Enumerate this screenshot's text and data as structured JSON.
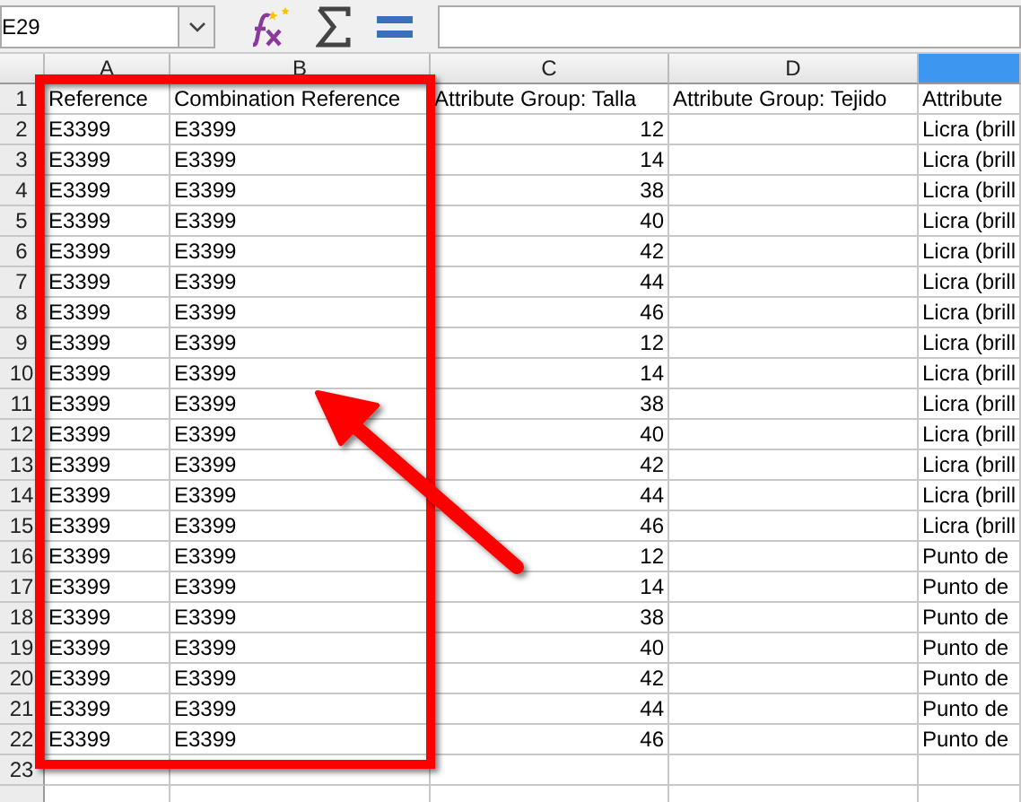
{
  "toolbar": {
    "name_box": "E29"
  },
  "columns": [
    {
      "letter": "A",
      "selected": false,
      "kind": "text"
    },
    {
      "letter": "B",
      "selected": false,
      "kind": "text"
    },
    {
      "letter": "C",
      "selected": false,
      "kind": "numeric"
    },
    {
      "letter": "D",
      "selected": false,
      "kind": "text"
    },
    {
      "selected": true,
      "kind": "text"
    }
  ],
  "rows": [
    {
      "number": "1",
      "kind": "header",
      "cells": [
        "Reference",
        "Combination Reference",
        "Attribute Group: Talla",
        "Attribute Group: Tejido",
        "Attribute"
      ]
    },
    {
      "number": "2",
      "kind": "data",
      "cells": [
        "E3399",
        "E3399",
        "12",
        null,
        "Licra (brill"
      ]
    },
    {
      "number": "3",
      "kind": "data",
      "cells": [
        "E3399",
        "E3399",
        "14",
        null,
        "Licra (brill"
      ]
    },
    {
      "number": "4",
      "kind": "data",
      "cells": [
        "E3399",
        "E3399",
        "38",
        null,
        "Licra (brill"
      ]
    },
    {
      "number": "5",
      "kind": "data",
      "cells": [
        "E3399",
        "E3399",
        "40",
        null,
        "Licra (brill"
      ]
    },
    {
      "number": "6",
      "kind": "data",
      "cells": [
        "E3399",
        "E3399",
        "42",
        null,
        "Licra (brill"
      ]
    },
    {
      "number": "7",
      "kind": "data",
      "cells": [
        "E3399",
        "E3399",
        "44",
        null,
        "Licra (brill"
      ]
    },
    {
      "number": "8",
      "kind": "data",
      "cells": [
        "E3399",
        "E3399",
        "46",
        null,
        "Licra (brill"
      ]
    },
    {
      "number": "9",
      "kind": "data",
      "cells": [
        "E3399",
        "E3399",
        "12",
        null,
        "Licra (brill"
      ]
    },
    {
      "number": "10",
      "kind": "data",
      "cells": [
        "E3399",
        "E3399",
        "14",
        null,
        "Licra (brill"
      ]
    },
    {
      "number": "11",
      "kind": "data",
      "cells": [
        "E3399",
        "E3399",
        "38",
        null,
        "Licra (brill"
      ]
    },
    {
      "number": "12",
      "kind": "data",
      "cells": [
        "E3399",
        "E3399",
        "40",
        null,
        "Licra (brill"
      ]
    },
    {
      "number": "13",
      "kind": "data",
      "cells": [
        "E3399",
        "E3399",
        "42",
        null,
        "Licra (brill"
      ]
    },
    {
      "number": "14",
      "kind": "data",
      "cells": [
        "E3399",
        "E3399",
        "44",
        null,
        "Licra (brill"
      ]
    },
    {
      "number": "15",
      "kind": "data",
      "cells": [
        "E3399",
        "E3399",
        "46",
        null,
        "Licra (brill"
      ]
    },
    {
      "number": "16",
      "kind": "data",
      "cells": [
        "E3399",
        "E3399",
        "12",
        null,
        "Punto de"
      ]
    },
    {
      "number": "17",
      "kind": "data",
      "cells": [
        "E3399",
        "E3399",
        "14",
        null,
        "Punto de"
      ]
    },
    {
      "number": "18",
      "kind": "data",
      "cells": [
        "E3399",
        "E3399",
        "38",
        null,
        "Punto de"
      ]
    },
    {
      "number": "19",
      "kind": "data",
      "cells": [
        "E3399",
        "E3399",
        "40",
        null,
        "Punto de"
      ]
    },
    {
      "number": "20",
      "kind": "data",
      "cells": [
        "E3399",
        "E3399",
        "42",
        null,
        "Punto de"
      ]
    },
    {
      "number": "21",
      "kind": "data",
      "cells": [
        "E3399",
        "E3399",
        "44",
        null,
        "Punto de"
      ]
    },
    {
      "number": "22",
      "kind": "data",
      "cells": [
        "E3399",
        "E3399",
        "46",
        null,
        "Punto de"
      ]
    },
    {
      "number": "23",
      "kind": "data",
      "cells": []
    }
  ]
}
